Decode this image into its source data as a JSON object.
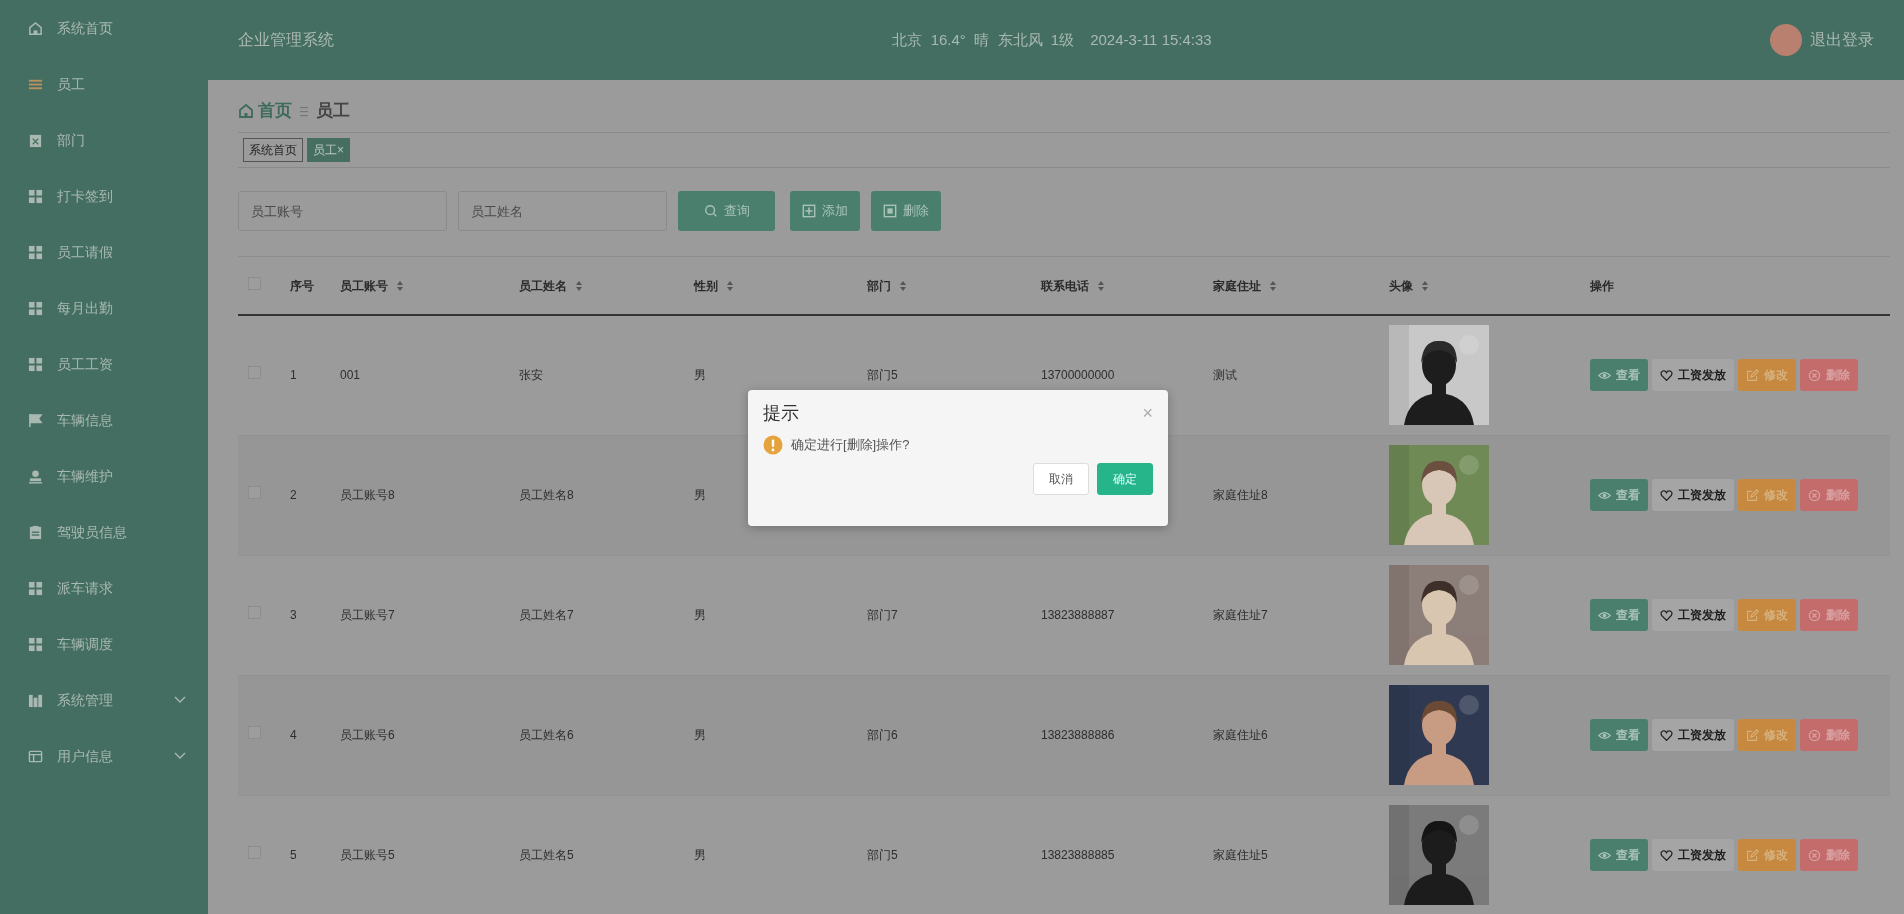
{
  "sidebar": {
    "items": [
      {
        "label": "系统首页",
        "selected": false
      },
      {
        "label": "员工",
        "selected": true
      },
      {
        "label": "部门",
        "selected": false
      },
      {
        "label": "打卡签到",
        "selected": false
      },
      {
        "label": "员工请假",
        "selected": false
      },
      {
        "label": "每月出勤",
        "selected": false
      },
      {
        "label": "员工工资",
        "selected": false
      },
      {
        "label": "车辆信息",
        "selected": false
      },
      {
        "label": "车辆维护",
        "selected": false
      },
      {
        "label": "驾驶员信息",
        "selected": false
      },
      {
        "label": "派车请求",
        "selected": false
      },
      {
        "label": "车辆调度",
        "selected": false
      },
      {
        "label": "系统管理",
        "selected": false,
        "expanded": false
      },
      {
        "label": "用户信息",
        "selected": false,
        "expanded": false
      }
    ]
  },
  "header": {
    "title": "企业管理系统",
    "weather": "北京  16.4°  晴  东北风  1级",
    "datetime": "2024-3-11 15:4:33",
    "logout": "退出登录"
  },
  "breadcrumb": {
    "home": "首页",
    "current": "员工"
  },
  "tags": [
    {
      "label": "系统首页",
      "selected": false
    },
    {
      "label": "员工",
      "selected": true,
      "close": "×"
    }
  ],
  "search": {
    "fields": [
      {
        "placeholder": "员工账号"
      },
      {
        "placeholder": "员工姓名"
      }
    ],
    "buttons": [
      {
        "kind": "search",
        "label": "查询"
      },
      {
        "kind": "add",
        "label": "添加"
      },
      {
        "kind": "delete",
        "label": "删除"
      }
    ]
  },
  "table": {
    "select_all": {
      "checked": false
    },
    "columns": [
      {
        "label": "序号",
        "sortable": false
      },
      {
        "label": "员工账号",
        "sortable": true
      },
      {
        "label": "员工姓名",
        "sortable": true
      },
      {
        "label": "性别",
        "sortable": true
      },
      {
        "label": "部门",
        "sortable": true
      },
      {
        "label": "联系电话",
        "sortable": true
      },
      {
        "label": "家庭住址",
        "sortable": true
      },
      {
        "label": "头像",
        "sortable": true
      },
      {
        "label": "操作",
        "sortable": false
      }
    ],
    "rows": [
      {
        "checked": false,
        "cells": [
          "1",
          "001",
          "张安",
          "男",
          "部门5",
          "13700000000",
          "测试"
        ],
        "photo": {
          "kind": "picture"
        },
        "actions": [
          {
            "kind": "view",
            "label": "查看"
          },
          {
            "kind": "pay",
            "label": "工资发放"
          },
          {
            "kind": "edit",
            "label": "修改"
          },
          {
            "kind": "delete",
            "label": "删除"
          }
        ]
      },
      {
        "checked": false,
        "cells": [
          "2",
          "员工账号8",
          "员工姓名8",
          "男",
          null,
          null,
          "家庭住址8"
        ],
        "photo": {
          "kind": "picture"
        },
        "actions": [
          {
            "kind": "view",
            "label": "查看"
          },
          {
            "kind": "pay",
            "label": "工资发放"
          },
          {
            "kind": "edit",
            "label": "修改"
          },
          {
            "kind": "delete",
            "label": "删除"
          }
        ]
      },
      {
        "checked": false,
        "cells": [
          "3",
          "员工账号7",
          "员工姓名7",
          "男",
          "部门7",
          "13823888887",
          "家庭住址7"
        ],
        "photo": {
          "kind": "picture"
        },
        "actions": [
          {
            "kind": "view",
            "label": "查看"
          },
          {
            "kind": "pay",
            "label": "工资发放"
          },
          {
            "kind": "edit",
            "label": "修改"
          },
          {
            "kind": "delete",
            "label": "删除"
          }
        ]
      },
      {
        "checked": false,
        "cells": [
          "4",
          "员工账号6",
          "员工姓名6",
          "男",
          "部门6",
          "13823888886",
          "家庭住址6"
        ],
        "photo": {
          "kind": "picture"
        },
        "actions": [
          {
            "kind": "view",
            "label": "查看"
          },
          {
            "kind": "pay",
            "label": "工资发放"
          },
          {
            "kind": "edit",
            "label": "修改"
          },
          {
            "kind": "delete",
            "label": "删除"
          }
        ]
      },
      {
        "checked": false,
        "cells": [
          "5",
          "员工账号5",
          "员工姓名5",
          "男",
          "部门5",
          "13823888885",
          "家庭住址5"
        ],
        "photo": {
          "kind": "picture"
        },
        "actions": [
          {
            "kind": "view",
            "label": "查看"
          },
          {
            "kind": "pay",
            "label": "工资发放"
          },
          {
            "kind": "edit",
            "label": "修改"
          },
          {
            "kind": "delete",
            "label": "删除"
          }
        ]
      }
    ]
  },
  "dialog": {
    "title": "提示",
    "close": "×",
    "message": "确定进行[删除]操作?",
    "buttons": [
      {
        "kind": "cancel",
        "label": "取消"
      },
      {
        "kind": "confirm",
        "label": "确定"
      }
    ]
  }
}
